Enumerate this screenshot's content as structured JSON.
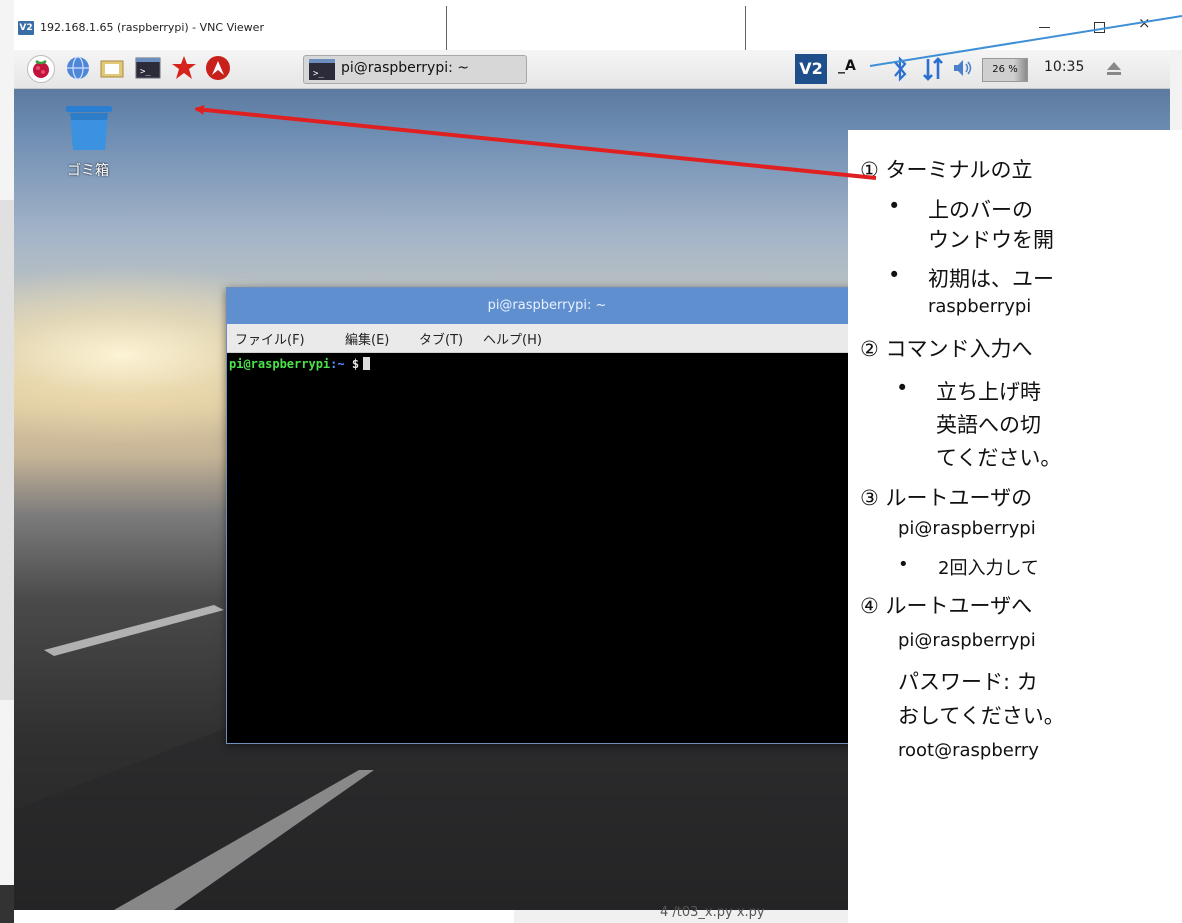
{
  "window": {
    "title": "192.168.1.65 (raspberrypi) - VNC Viewer",
    "logo_text": "V2",
    "close_glyph": "×"
  },
  "panel": {
    "launchers": [
      "raspberry-menu-icon",
      "web-browser-icon",
      "file-manager-icon",
      "terminal-icon",
      "mathematica-icon",
      "wolfram-icon"
    ],
    "task_label": "pi@raspberrypi: ~",
    "tray": {
      "vnc_label": "V2",
      "ime_label": "_A",
      "cpu_label": "26 %",
      "clock": "10:35"
    }
  },
  "desktop": {
    "trash_label": "ゴミ箱"
  },
  "terminal": {
    "title": "pi@raspberrypi: ~",
    "menu": [
      "ファイル(F)",
      "編集(E)",
      "タブ(T)",
      "ヘルプ(H)"
    ],
    "prompt_user": "pi@raspberrypi",
    "prompt_path": ":~",
    "prompt_dollar": " $"
  },
  "notes": [
    "① ターミナルの立",
    "上のバーの",
    "ウンドウを開",
    "初期は、ユー",
    "raspberrypi",
    "② コマンド入力へ",
    "立ち上げ時",
    "英語への切",
    "てください。",
    "③ ルートユーザの",
    "pi@raspberrypi",
    "2回入力して",
    "④ ルートユーザへ",
    "pi@raspberrypi",
    "パスワード: カ",
    "おしてください。",
    "root@raspberry"
  ],
  "bottom_text": "4 /t03_x.py     x.py",
  "colors": {
    "arrow": "#e02020",
    "pointer": "#3f8fd6",
    "term_title": "#5f8fce"
  }
}
